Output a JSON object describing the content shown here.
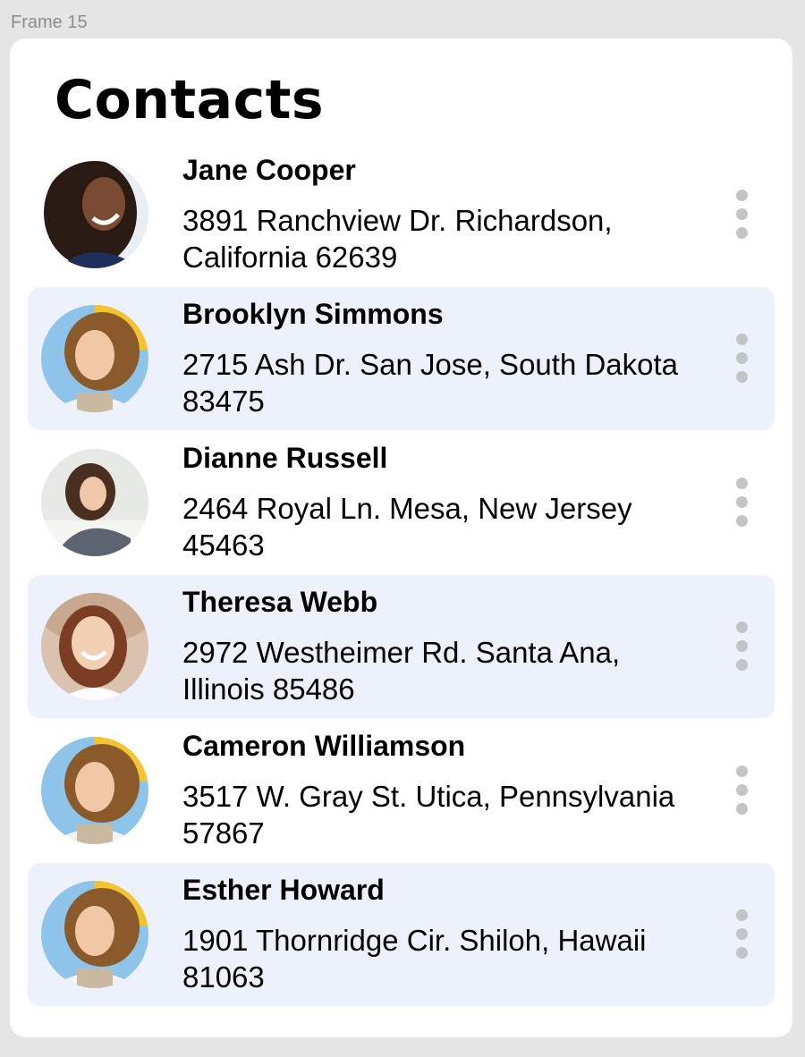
{
  "frame": {
    "label": "Frame 15"
  },
  "header": {
    "title": "Contacts"
  },
  "contacts": [
    {
      "name": "Jane Cooper",
      "address": "3891 Ranchview Dr. Richardson, California 62639"
    },
    {
      "name": "Brooklyn Simmons",
      "address": "2715 Ash Dr. San Jose, South Dakota 83475"
    },
    {
      "name": "Dianne Russell",
      "address": "2464 Royal Ln. Mesa, New Jersey 45463"
    },
    {
      "name": "Theresa Webb",
      "address": "2972 Westheimer Rd. Santa Ana, Illinois 85486"
    },
    {
      "name": "Cameron Williamson",
      "address": "3517 W. Gray St. Utica, Pennsylvania 57867"
    },
    {
      "name": "Esther Howard",
      "address": "1901 Thornridge Cir. Shiloh, Hawaii 81063"
    }
  ],
  "icons": {
    "row_menu": "more-vertical-icon"
  },
  "colors": {
    "row_alt_background": "#edf1fb",
    "menu_dots": "#c4c4c4"
  }
}
